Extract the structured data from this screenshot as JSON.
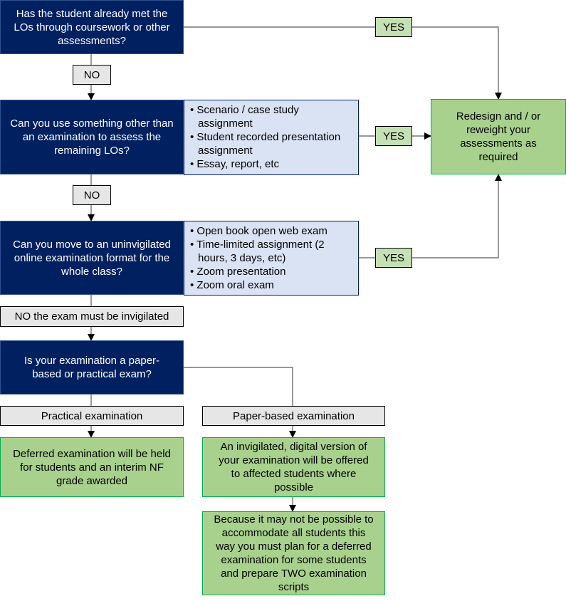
{
  "nodes": {
    "q1": "Has the student already met the LOs through coursework or other assessments?",
    "q2": "Can you use something other than an examination to assess the remaining LOs?",
    "q2_options": [
      "Scenario / case study assignment",
      "Student recorded presentation assignment",
      "Essay, report, etc"
    ],
    "q3": "Can you move to an uninvigilated online examination format for the whole class?",
    "q3_options": [
      "Open book open web exam",
      "Time-limited assignment (2 hours, 3 days, etc)",
      "Zoom presentation",
      "Zoom oral exam"
    ],
    "q4": "Is your examination a paper-based or practical exam?",
    "redesign": "Redesign and / or reweight your assessments as required",
    "practical_label": "Practical examination",
    "paper_label": "Paper-based examination",
    "deferred": "Deferred examination will be held for students and an interim NF grade awarded",
    "digital": "An invigilated, digital version of your examination will be offered to affected students where possible",
    "two_scripts": "Because it may not be possible to accommodate all students this way you must plan for a deferred examination for some students and prepare TWO examination scripts"
  },
  "edges": {
    "yes": "YES",
    "no": "NO",
    "no_invigilated": "NO the exam must be invigilated"
  },
  "colors": {
    "question": "#002060",
    "options": "#dae3f3",
    "outcome": "#a9d18e",
    "yes_label": "#c5e0b4",
    "neutral_label": "#e7e6e6"
  }
}
